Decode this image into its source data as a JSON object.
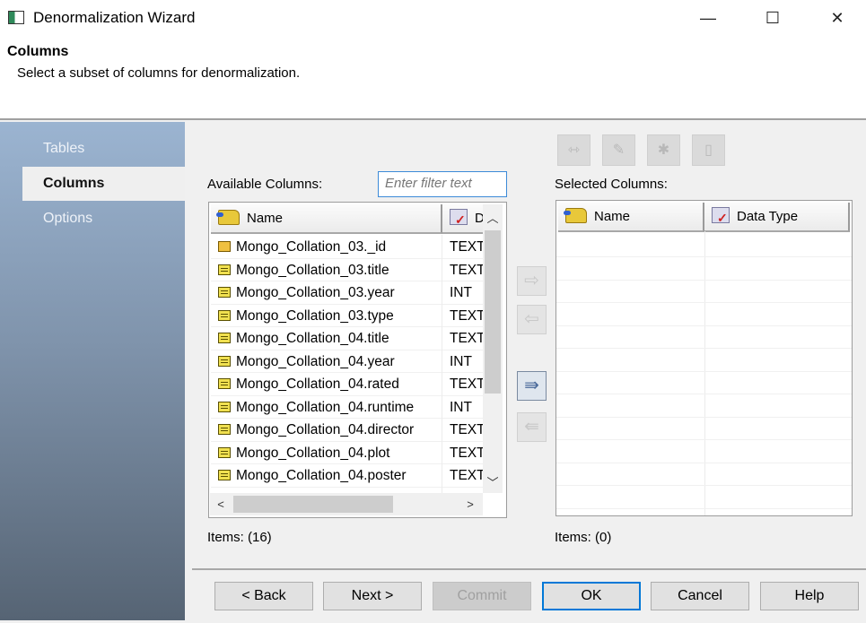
{
  "window": {
    "title": "Denormalization Wizard",
    "minimize": "—",
    "maximize": "☐",
    "close": "✕"
  },
  "header": {
    "title": "Columns",
    "subtitle": "Select a subset of columns for denormalization."
  },
  "sidebar": {
    "items": [
      {
        "label": "Tables",
        "selected": false
      },
      {
        "label": "Columns",
        "selected": true
      },
      {
        "label": "Options",
        "selected": false
      }
    ]
  },
  "available": {
    "label": "Available Columns:",
    "filter_placeholder": "Enter filter text",
    "columns": [
      "Name",
      "Data Type"
    ],
    "type_header_visible": "D",
    "rows": [
      {
        "name": "Mongo_Collation_03._id",
        "type": "TEXT",
        "key": true
      },
      {
        "name": "Mongo_Collation_03.title",
        "type": "TEXT"
      },
      {
        "name": "Mongo_Collation_03.year",
        "type": "INT"
      },
      {
        "name": "Mongo_Collation_03.type",
        "type": "TEXT"
      },
      {
        "name": "Mongo_Collation_04.title",
        "type": "TEXT"
      },
      {
        "name": "Mongo_Collation_04.year",
        "type": "INT"
      },
      {
        "name": "Mongo_Collation_04.rated",
        "type": "TEXT"
      },
      {
        "name": "Mongo_Collation_04.runtime",
        "type": "INT"
      },
      {
        "name": "Mongo_Collation_04.director",
        "type": "TEXT"
      },
      {
        "name": "Mongo_Collation_04.plot",
        "type": "TEXT"
      },
      {
        "name": "Mongo_Collation_04.poster",
        "type": "TEXT"
      }
    ],
    "items": "Items: (16)"
  },
  "selected": {
    "label": "Selected Columns:",
    "columns": [
      "Name",
      "Data Type"
    ],
    "items": "Items: (0)"
  },
  "buttons": {
    "back": "< Back",
    "next": "Next >",
    "commit": "Commit",
    "ok": "OK",
    "cancel": "Cancel",
    "help": "Help"
  }
}
